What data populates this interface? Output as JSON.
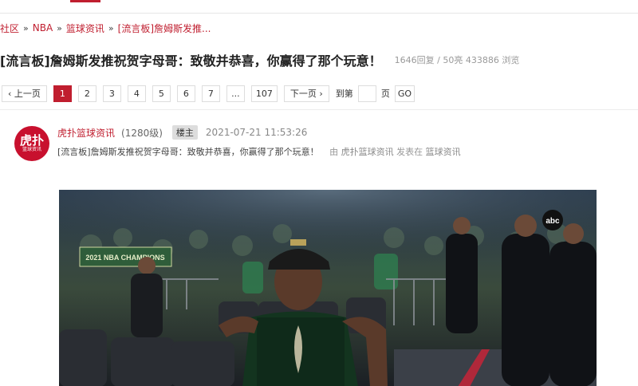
{
  "breadcrumb": {
    "items": [
      "社区",
      "NBA",
      "篮球资讯",
      "[流言板]詹姆斯发推..."
    ],
    "separator": "»"
  },
  "thread": {
    "title": "[流言板]詹姆斯发推祝贺字母哥：致敬并恭喜，你赢得了那个玩意！",
    "stats": "1646回复 / 50亮 433886 浏览"
  },
  "pager": {
    "prev_label": "‹ 上一页",
    "pages": [
      "1",
      "2",
      "3",
      "4",
      "5",
      "6",
      "7",
      "...",
      "107"
    ],
    "active_page": "1",
    "next_label": "下一页 ›",
    "goto_label": "到第",
    "page_unit": "页",
    "go_label": "GO"
  },
  "post": {
    "avatar_text_big": "虎扑",
    "avatar_text_small": "篮球资讯",
    "author": "虎扑篮球资讯",
    "level": "(1280级)",
    "badge": "楼主",
    "time": "2021-07-21 11:53:26",
    "subject": "[流言板]詹姆斯发推祝贺字母哥：致敬并恭喜，你赢得了那个玩意！",
    "meta_by": "由",
    "meta_author": "虎扑篮球资讯",
    "meta_published": "发表在",
    "meta_board": "篮球资讯",
    "photo_banner": "2021 NBA CHAMPIONS",
    "photo_abc": "abc"
  },
  "colors": {
    "brand_red": "#c01e2f",
    "page_bg": "#f4f4f4"
  }
}
